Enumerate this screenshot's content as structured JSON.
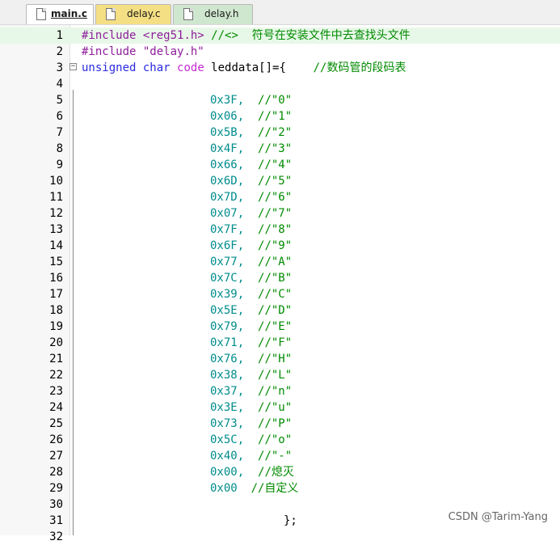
{
  "tabs": [
    {
      "label": "main.c"
    },
    {
      "label": "delay.c"
    },
    {
      "label": "delay.h"
    }
  ],
  "code": {
    "line1": {
      "directive": "#include",
      "header": "<reg51.h>",
      "comment": "//<>  符号在安装文件中去查找头文件"
    },
    "line2": {
      "directive": "#include",
      "header": "\"delay.h\""
    },
    "line3": {
      "kw1": "unsigned",
      "kw2": "char",
      "kw3": "code",
      "decl": " leddata[]={",
      "comment": "//数码管的段码表"
    },
    "entries": [
      {
        "value": "0x3F,",
        "comment": "//\"0\""
      },
      {
        "value": "0x06,",
        "comment": "//\"1\""
      },
      {
        "value": "0x5B,",
        "comment": "//\"2\""
      },
      {
        "value": "0x4F,",
        "comment": "//\"3\""
      },
      {
        "value": "0x66,",
        "comment": "//\"4\""
      },
      {
        "value": "0x6D,",
        "comment": "//\"5\""
      },
      {
        "value": "0x7D,",
        "comment": "//\"6\""
      },
      {
        "value": "0x07,",
        "comment": "//\"7\""
      },
      {
        "value": "0x7F,",
        "comment": "//\"8\""
      },
      {
        "value": "0x6F,",
        "comment": "//\"9\""
      },
      {
        "value": "0x77,",
        "comment": "//\"A\""
      },
      {
        "value": "0x7C,",
        "comment": "//\"B\""
      },
      {
        "value": "0x39,",
        "comment": "//\"C\""
      },
      {
        "value": "0x5E,",
        "comment": "//\"D\""
      },
      {
        "value": "0x79,",
        "comment": "//\"E\""
      },
      {
        "value": "0x71,",
        "comment": "//\"F\""
      },
      {
        "value": "0x76,",
        "comment": "//\"H\""
      },
      {
        "value": "0x38,",
        "comment": "//\"L\""
      },
      {
        "value": "0x37,",
        "comment": "//\"n\""
      },
      {
        "value": "0x3E,",
        "comment": "//\"u\""
      },
      {
        "value": "0x73,",
        "comment": "//\"P\""
      },
      {
        "value": "0x5C,",
        "comment": "//\"o\""
      },
      {
        "value": "0x40,",
        "comment": "//\"-\""
      },
      {
        "value": "0x00,",
        "comment": "//熄灭"
      },
      {
        "value": "0x00",
        "comment": "//自定义"
      }
    ],
    "line31": "};"
  },
  "line_numbers": [
    "1",
    "2",
    "3",
    "4",
    "5",
    "6",
    "7",
    "8",
    "9",
    "10",
    "11",
    "12",
    "13",
    "14",
    "15",
    "16",
    "17",
    "18",
    "19",
    "20",
    "21",
    "22",
    "23",
    "24",
    "25",
    "26",
    "27",
    "28",
    "29",
    "30",
    "31",
    "32"
  ],
  "fold_icon": "minus-box-icon",
  "colors": {
    "keyword": "#2a2ae0",
    "keyword_alt": "#c32bd0",
    "preprocessor": "#8e1d9a",
    "comment": "#008a00",
    "number": "#008c8c",
    "current_line": "#e8f8e8",
    "tab_active": "#ffffff",
    "tab_delay_c": "#f5df84",
    "tab_delay_h": "#cfe6cf"
  },
  "watermark": "CSDN @Tarim-Yang"
}
